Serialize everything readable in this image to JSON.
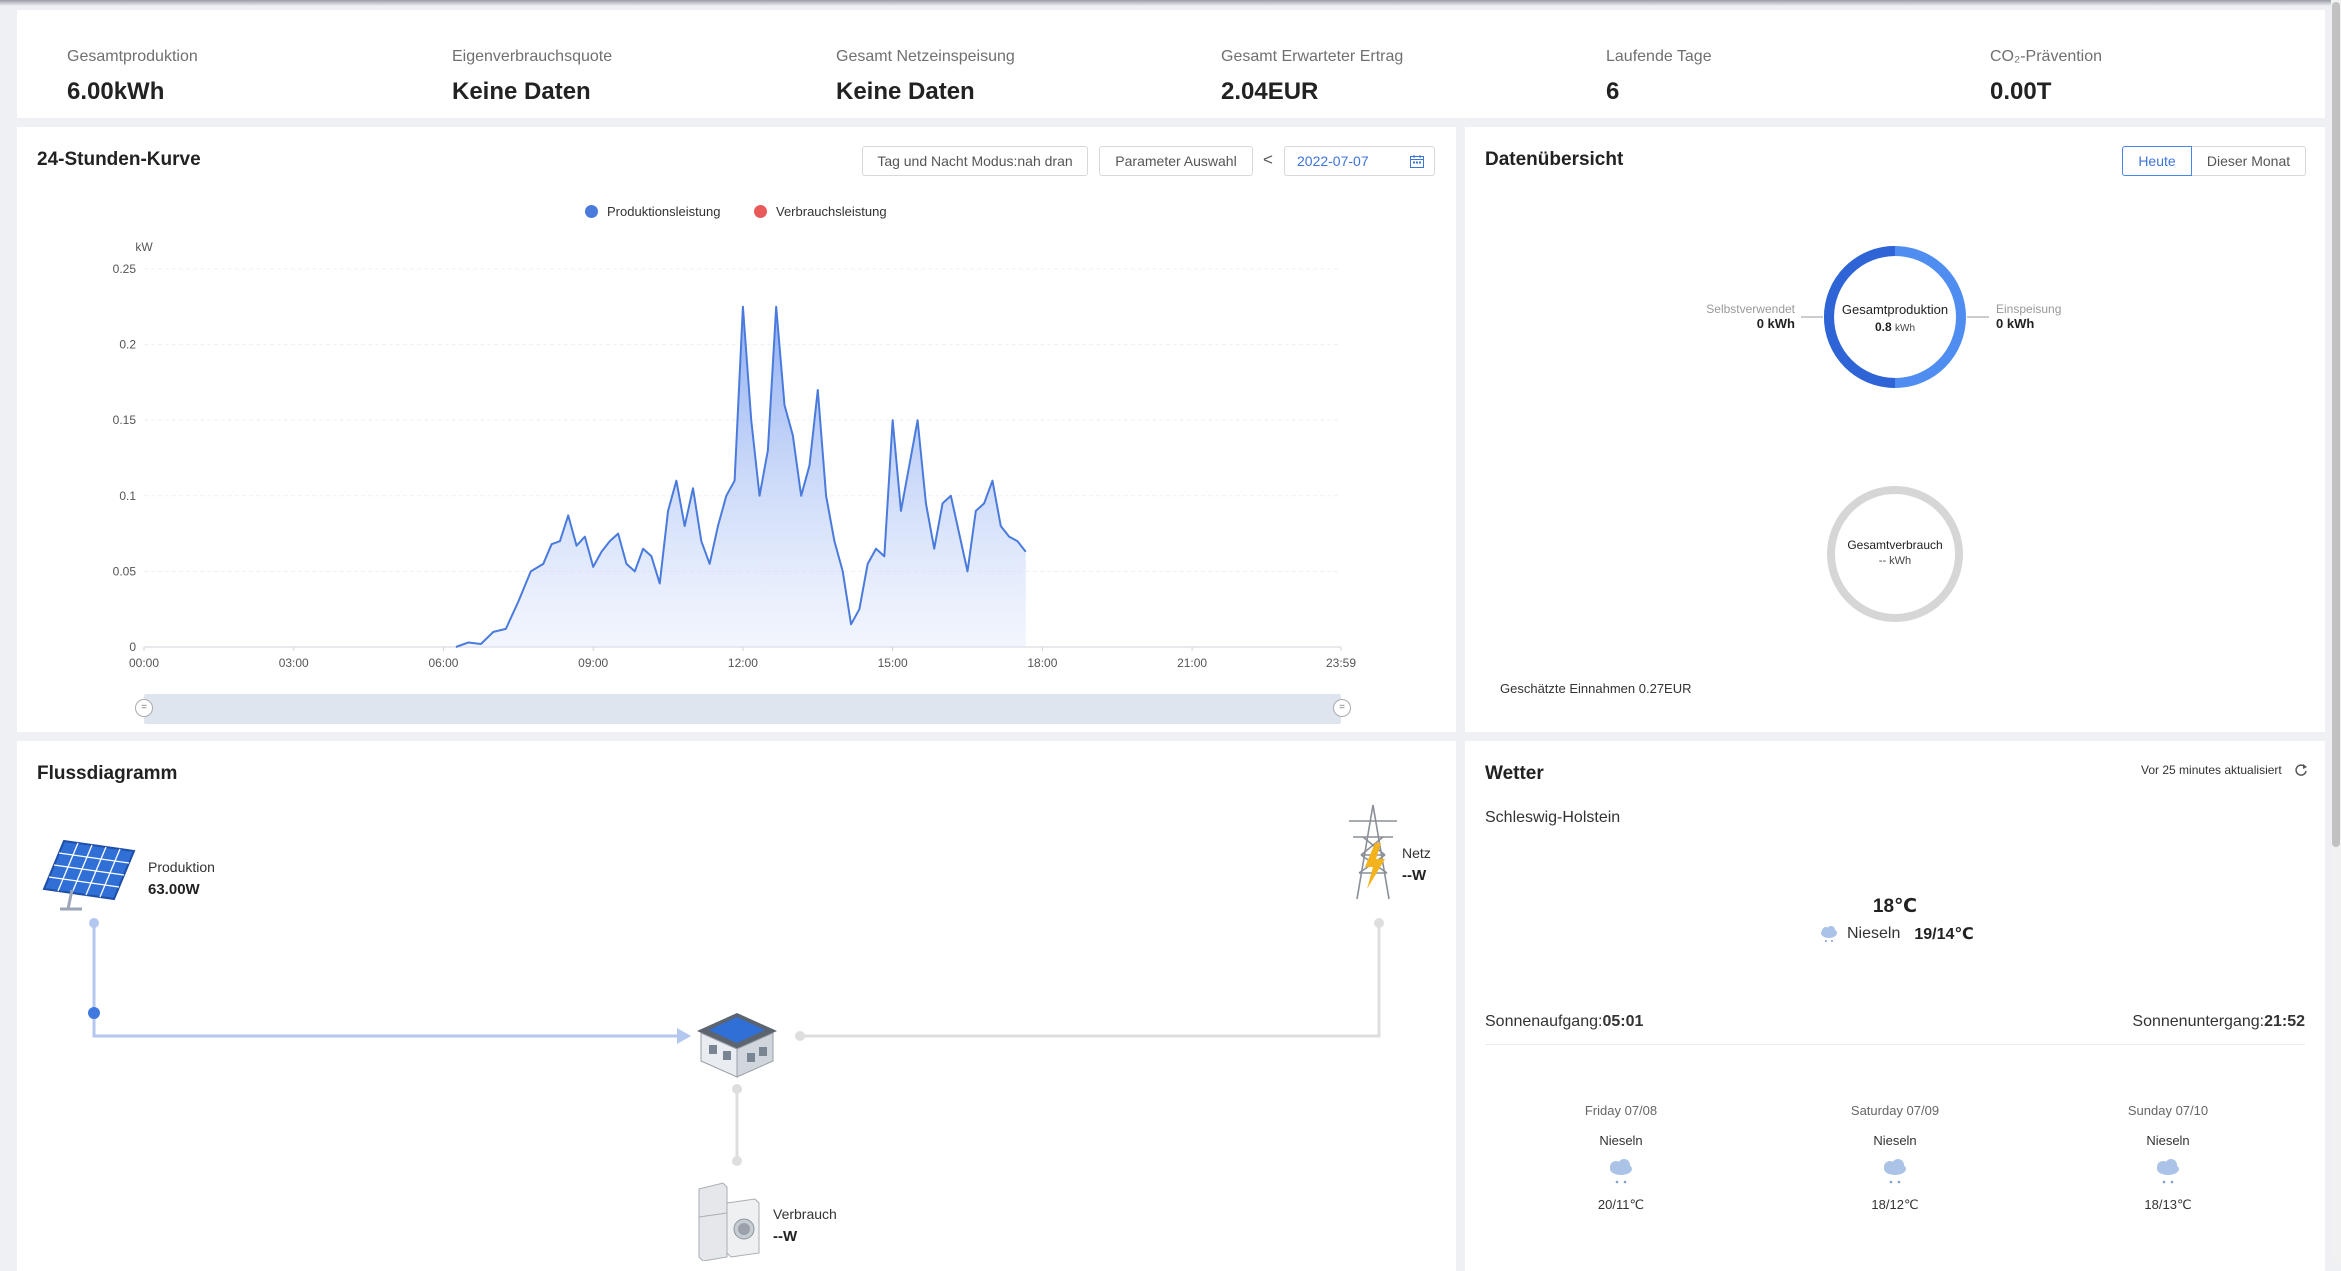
{
  "stats": [
    {
      "label": "Gesamtproduktion",
      "value": "6.00kWh"
    },
    {
      "label": "Eigenverbrauchsquote",
      "value": "Keine Daten"
    },
    {
      "label": "Gesamt Netzeinspeisung",
      "value": "Keine Daten"
    },
    {
      "label": "Gesamt Erwarteter Ertrag",
      "value": "2.04EUR"
    },
    {
      "label": "Laufende Tage",
      "value": "6"
    },
    {
      "label": "CO₂-Prävention",
      "value": "0.00T"
    }
  ],
  "curve": {
    "title": "24-Stunden-Kurve",
    "mode_button": "Tag und Nacht Modus:nah dran",
    "param_button": "Parameter Auswahl",
    "prev_symbol": "<",
    "date": "2022-07-07"
  },
  "chart_data": {
    "type": "area",
    "ylabel": "kW",
    "ylim": [
      0,
      0.25
    ],
    "yticks": [
      "0",
      "0.05",
      "0.1",
      "0.15",
      "0.2",
      "0.25"
    ],
    "xticks": [
      "00:00",
      "03:00",
      "06:00",
      "09:00",
      "12:00",
      "15:00",
      "18:00",
      "21:00",
      "23:59"
    ],
    "series": [
      {
        "name": "Produktionsleistung",
        "color": "#4a7bdc",
        "points": [
          [
            "06:15",
            0.0
          ],
          [
            "06:30",
            0.003
          ],
          [
            "06:45",
            0.002
          ],
          [
            "07:00",
            0.01
          ],
          [
            "07:15",
            0.012
          ],
          [
            "07:30",
            0.03
          ],
          [
            "07:45",
            0.05
          ],
          [
            "08:00",
            0.055
          ],
          [
            "08:10",
            0.068
          ],
          [
            "08:20",
            0.07
          ],
          [
            "08:30",
            0.087
          ],
          [
            "08:40",
            0.067
          ],
          [
            "08:50",
            0.073
          ],
          [
            "09:00",
            0.053
          ],
          [
            "09:10",
            0.063
          ],
          [
            "09:20",
            0.07
          ],
          [
            "09:30",
            0.075
          ],
          [
            "09:40",
            0.055
          ],
          [
            "09:50",
            0.05
          ],
          [
            "10:00",
            0.065
          ],
          [
            "10:10",
            0.06
          ],
          [
            "10:20",
            0.042
          ],
          [
            "10:30",
            0.09
          ],
          [
            "10:40",
            0.11
          ],
          [
            "10:50",
            0.08
          ],
          [
            "11:00",
            0.105
          ],
          [
            "11:10",
            0.07
          ],
          [
            "11:20",
            0.055
          ],
          [
            "11:30",
            0.08
          ],
          [
            "11:40",
            0.1
          ],
          [
            "11:50",
            0.11
          ],
          [
            "12:00",
            0.225
          ],
          [
            "12:10",
            0.15
          ],
          [
            "12:20",
            0.1
          ],
          [
            "12:30",
            0.13
          ],
          [
            "12:40",
            0.225
          ],
          [
            "12:50",
            0.16
          ],
          [
            "13:00",
            0.14
          ],
          [
            "13:10",
            0.1
          ],
          [
            "13:20",
            0.12
          ],
          [
            "13:30",
            0.17
          ],
          [
            "13:40",
            0.1
          ],
          [
            "13:50",
            0.07
          ],
          [
            "14:00",
            0.05
          ],
          [
            "14:10",
            0.015
          ],
          [
            "14:20",
            0.025
          ],
          [
            "14:30",
            0.055
          ],
          [
            "14:40",
            0.065
          ],
          [
            "14:50",
            0.06
          ],
          [
            "15:00",
            0.15
          ],
          [
            "15:10",
            0.09
          ],
          [
            "15:20",
            0.12
          ],
          [
            "15:30",
            0.15
          ],
          [
            "15:40",
            0.095
          ],
          [
            "15:50",
            0.065
          ],
          [
            "16:00",
            0.095
          ],
          [
            "16:10",
            0.1
          ],
          [
            "16:20",
            0.075
          ],
          [
            "16:30",
            0.05
          ],
          [
            "16:40",
            0.09
          ],
          [
            "16:50",
            0.095
          ],
          [
            "17:00",
            0.11
          ],
          [
            "17:10",
            0.08
          ],
          [
            "17:20",
            0.073
          ],
          [
            "17:30",
            0.07
          ],
          [
            "17:40",
            0.063
          ]
        ]
      },
      {
        "name": "Verbrauchsleistung",
        "color": "#e85a5a",
        "points": []
      }
    ]
  },
  "overview": {
    "title": "Datenübersicht",
    "tab_today": "Heute",
    "tab_month": "Dieser Monat",
    "prod_label": "Gesamtproduktion",
    "prod_value": "0.8",
    "prod_unit": "kWh",
    "self_label": "Selbstverwendet",
    "self_value": "0 kWh",
    "feed_label": "Einspeisung",
    "feed_value": "0 kWh",
    "cons_label": "Gesamtverbrauch",
    "cons_value": "-- kWh",
    "income": "Geschätzte Einnahmen 0.27EUR"
  },
  "flow": {
    "title": "Flussdiagramm",
    "prod_label": "Produktion",
    "prod_value": "63.00W",
    "grid_label": "Netz",
    "grid_value": "--W",
    "cons_label": "Verbrauch",
    "cons_value": "--W"
  },
  "weather": {
    "title": "Wetter",
    "updated": "Vor 25 minutes aktualisiert",
    "location": "Schleswig-Holstein",
    "temp": "18℃",
    "cond": "Nieseln",
    "range": "19/14℃",
    "sunrise_label": "Sonnenaufgang:",
    "sunrise": "05:01",
    "sunset_label": "Sonnenuntergang:",
    "sunset": "21:52",
    "forecast": [
      {
        "day": "Friday 07/08",
        "cond": "Nieseln",
        "range": "20/11℃"
      },
      {
        "day": "Saturday 07/09",
        "cond": "Nieseln",
        "range": "18/12℃"
      },
      {
        "day": "Sunday 07/10",
        "cond": "Nieseln",
        "range": "18/13℃"
      }
    ]
  }
}
